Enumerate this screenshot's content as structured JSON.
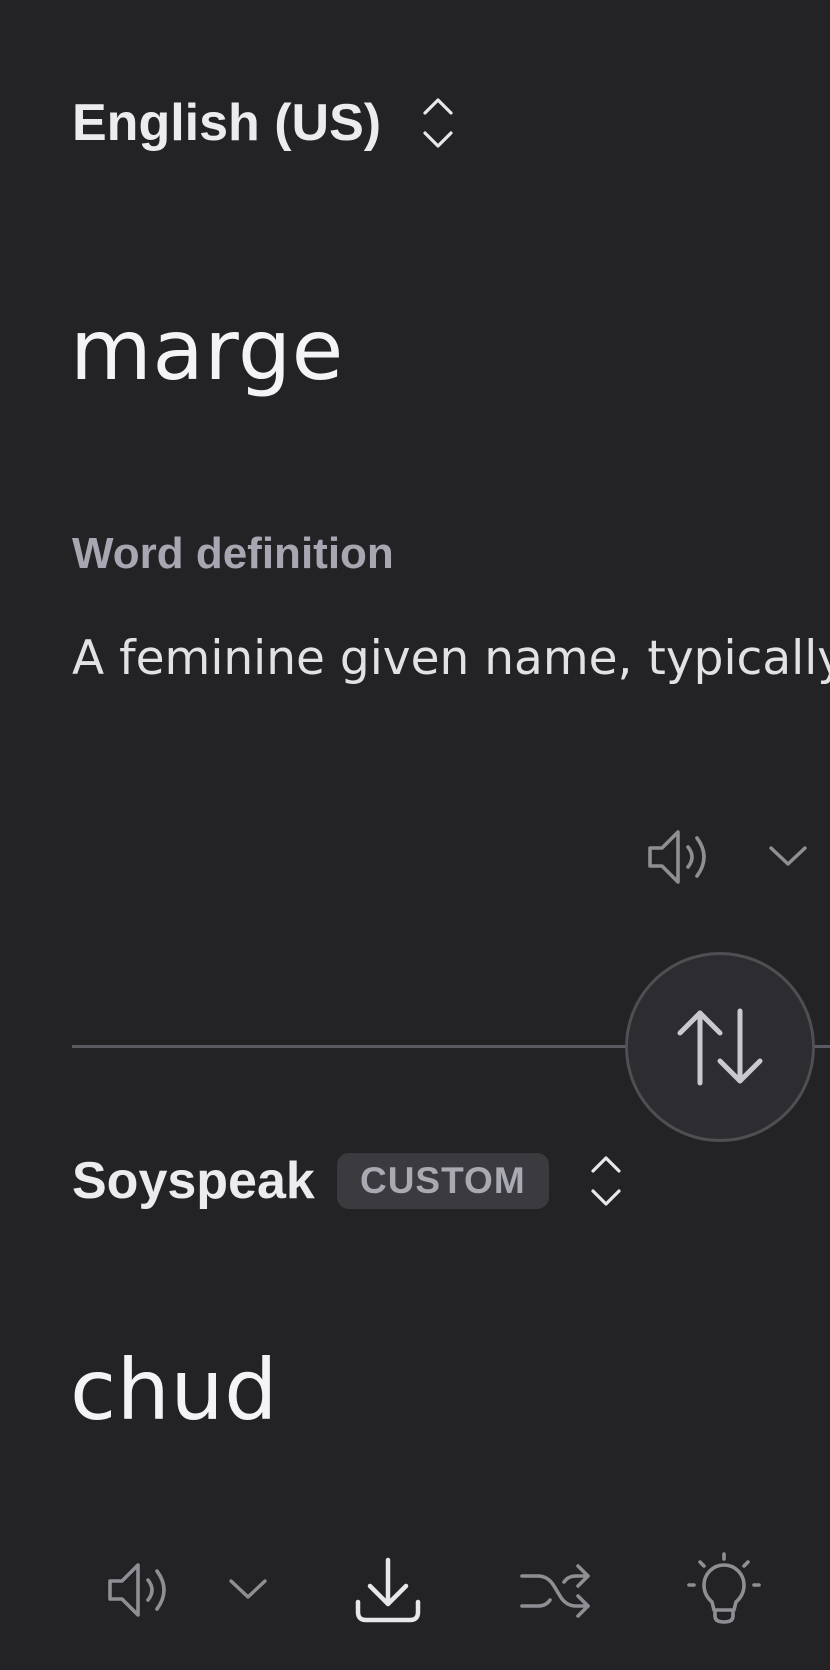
{
  "source": {
    "language_label": "English (US)",
    "text": "marge",
    "definition_title": "Word definition",
    "definition_text": "A feminine given name, typically"
  },
  "target": {
    "language_label": "Soyspeak",
    "badge": "CUSTOM",
    "text": "chud"
  },
  "icons": {
    "source_lang_selector": "chevron-up-down-icon",
    "source_speaker": "speaker-icon",
    "source_speaker_menu": "chevron-down-icon",
    "swap": "swap-arrows-icon",
    "target_lang_selector": "chevron-up-down-icon",
    "target_speaker": "speaker-icon",
    "target_speaker_menu": "chevron-down-icon",
    "download": "download-icon",
    "shuffle": "shuffle-icon",
    "idea": "lightbulb-icon"
  },
  "colors": {
    "background": "#232326",
    "text_primary": "#f4f4f6",
    "text_muted": "#a8a7b1",
    "badge_bg": "#3a3a3f",
    "icon_gray": "#8e8e94"
  }
}
